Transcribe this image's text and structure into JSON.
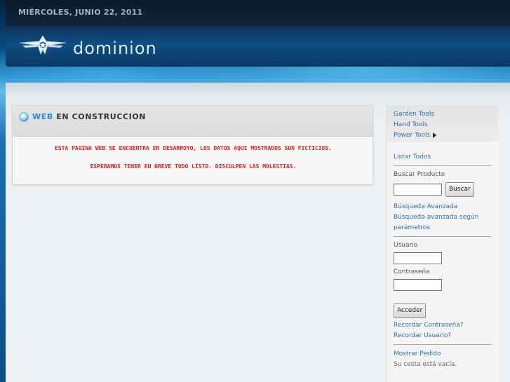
{
  "header": {
    "date": "MIÉRCOLES, JUNIO 22, 2011",
    "logo_text": "dominion"
  },
  "main": {
    "title_accent": "WEB",
    "title_rest": "EN CONSTRUCCION",
    "notice_line1": "ESTA PAGINA WEB SE ENCUENTRA EN DESARROYO, LOS DATOS AQUI MOSTRADOS SON FICTICIOS.",
    "notice_line2": "ESPERAMOS TENER EN BREVE TODO LISTO. DISCULPEN LAS MOLESTIAS."
  },
  "sidebar": {
    "categories": [
      "Garden Tools",
      "Hand Tools",
      "Power Tools"
    ],
    "list_all": "Listar Todos",
    "search_label": "Buscar Producto",
    "search_value": "",
    "search_button": "Buscar",
    "advanced_search": "Búsqueda Avanzada",
    "advanced_params_line1": "Búsqueda avanzada según",
    "advanced_params_line2": "parámetros",
    "user_label": "Usuario",
    "user_value": "",
    "password_label": "Contraseña",
    "password_value": "",
    "login_button": "Acceder",
    "forgot_password": "Recordar Contraseña?",
    "forgot_user": "Recordar Usuario?",
    "show_order": "Mostrar Pedido",
    "cart_status": "Su cesta está vacía."
  },
  "colors": {
    "accent": "#2b8ac9",
    "notice": "#e0201c",
    "link": "#2c6fa8"
  }
}
